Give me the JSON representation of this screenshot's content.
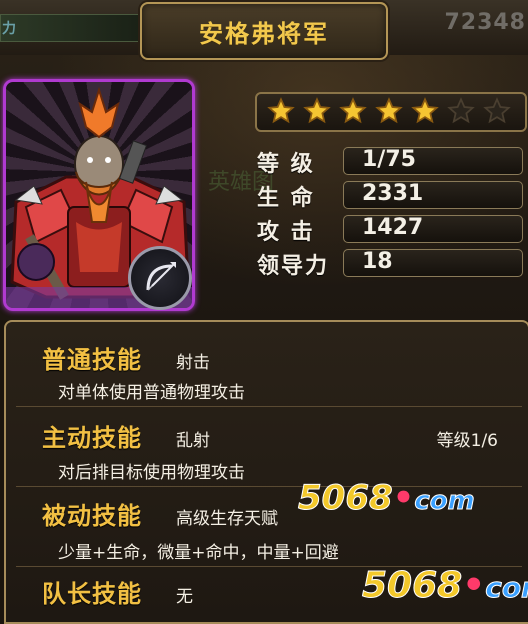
{
  "header": {
    "title": "安格弗将军",
    "left_text": "力",
    "right_number": "72348"
  },
  "hero": {
    "stars_filled": 5,
    "stars_total": 7,
    "background_text": "英雄图",
    "stats": [
      {
        "label": "等 级",
        "value": "1/75"
      },
      {
        "label": "生 命",
        "value": "2331"
      },
      {
        "label": "攻 击",
        "value": "1427"
      },
      {
        "label": "领导力",
        "value": "18"
      }
    ]
  },
  "skills": [
    {
      "title": "普通技能",
      "name": "射击",
      "desc": "对单体使用普通物理攻击",
      "level": ""
    },
    {
      "title": "主动技能",
      "name": "乱射",
      "desc": "对后排目标使用物理攻击",
      "level": "等级1/6"
    },
    {
      "title": "被动技能",
      "name": "高级生存天赋",
      "desc": "少量+生命，微量+命中，中量+回避",
      "level": ""
    },
    {
      "title": "队长技能",
      "name": "无",
      "desc": "",
      "level": ""
    }
  ],
  "watermarks": [
    {
      "digits": "5068",
      "dot": "•",
      "suffix": "com"
    },
    {
      "digits": "5068",
      "dot": "•",
      "suffix": "com"
    }
  ],
  "colors": {
    "title_gold": "#f2c84c",
    "skill_gold": "#f2c043",
    "portrait_border": "#b03ad0",
    "text_light": "#f4efe4"
  },
  "icons": {
    "class_badge": "bow-icon",
    "star": "star-icon"
  }
}
